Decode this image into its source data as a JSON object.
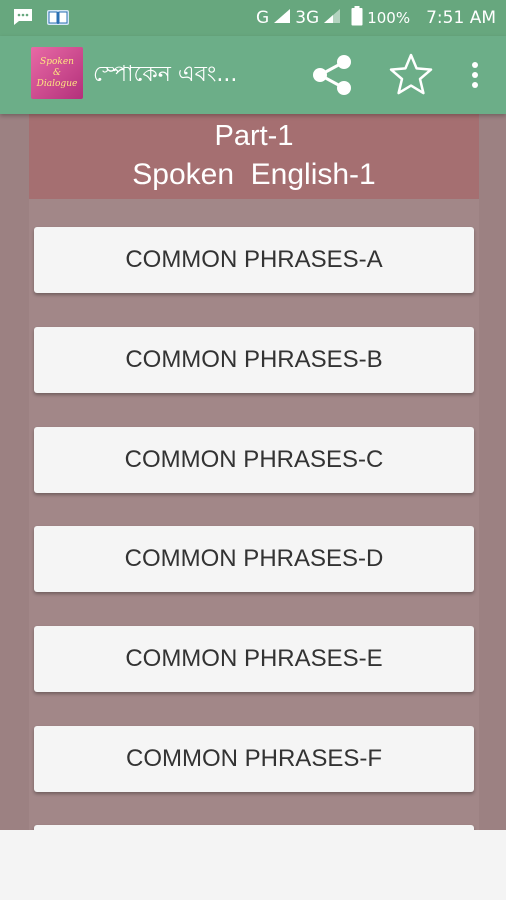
{
  "status_bar": {
    "network_g": "G",
    "network_3g": "3G",
    "battery": "100%",
    "time": "7:51 AM",
    "icons": [
      "message-icon",
      "book-notification-icon",
      "signal-icon",
      "signal-icon-2",
      "battery-icon"
    ]
  },
  "app_bar": {
    "logo_text": [
      "Spoken",
      "&",
      "Dialogue"
    ],
    "title": "স্পোকেন এবং...",
    "actions": [
      "share-icon",
      "star-icon",
      "overflow-menu-icon"
    ]
  },
  "header": {
    "part": "Part-1",
    "subtitle": "Spoken  English-1"
  },
  "phrases": [
    "COMMON PHRASES-A",
    "COMMON PHRASES-B",
    "COMMON PHRASES-C",
    "COMMON PHRASES-D",
    "COMMON PHRASES-E",
    "COMMON PHRASES-F"
  ],
  "colors": {
    "status_bar": "#67a77e",
    "app_bar": "#6cae88",
    "header": "#a56f71",
    "content_bg": "#9c8182",
    "button_bg": "#f5f5f5"
  }
}
